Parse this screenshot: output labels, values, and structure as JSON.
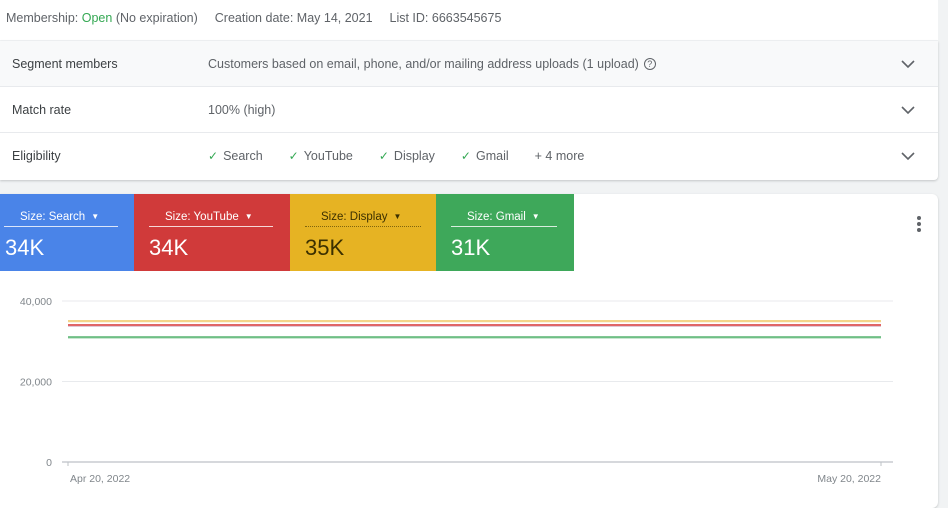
{
  "meta": {
    "membership_label": "Membership:",
    "membership_status": "Open",
    "membership_note": "(No expiration)",
    "creation_label": "Creation date:",
    "creation_date": "May 14, 2021",
    "list_id_label": "List ID:",
    "list_id": "6663545675"
  },
  "details": [
    {
      "label": "Segment members",
      "value": "Customers based on email, phone, and/or mailing address uploads (1 upload)",
      "help_icon": "?"
    },
    {
      "label": "Match rate",
      "value": "100% (high)"
    },
    {
      "label": "Eligibility",
      "items": [
        "Search",
        "YouTube",
        "Display",
        "Gmail"
      ],
      "more": "+ 4 more"
    }
  ],
  "tiles": [
    {
      "label": "Size: Search",
      "value": "34K",
      "color": "#4a84e8",
      "text_color": "#ffffff"
    },
    {
      "label": "Size: YouTube",
      "value": "34K",
      "color": "#d03a3a",
      "text_color": "#ffffff"
    },
    {
      "label": "Size: Display",
      "value": "35K",
      "color": "#e6b323",
      "text_color": "#3c3000"
    },
    {
      "label": "Size: Gmail",
      "value": "31K",
      "color": "#3ea85a",
      "text_color": "#ffffff"
    }
  ],
  "chart_data": {
    "type": "line",
    "x": [
      "Apr 20, 2022",
      "May 20, 2022"
    ],
    "xlabels": [
      "Apr 20, 2022",
      "May 20, 2022"
    ],
    "yticks": [
      0,
      20000,
      40000
    ],
    "ytick_labels": [
      "0",
      "20,000",
      "40,000"
    ],
    "ylim": [
      0,
      40000
    ],
    "grid": true,
    "series": [
      {
        "name": "Size: Search",
        "color": "#4a84e8",
        "values": [
          34000,
          34000
        ]
      },
      {
        "name": "Size: YouTube",
        "color": "#e06666",
        "values": [
          34000,
          34000
        ]
      },
      {
        "name": "Size: Display",
        "color": "#f3d58a",
        "values": [
          35000,
          35000
        ]
      },
      {
        "name": "Size: Gmail",
        "color": "#6fbf85",
        "values": [
          31000,
          31000
        ]
      }
    ]
  }
}
